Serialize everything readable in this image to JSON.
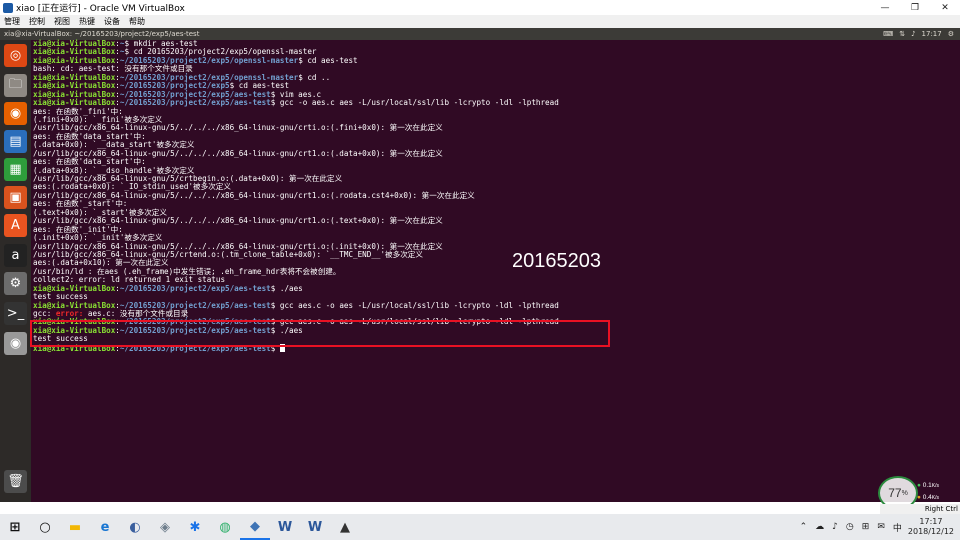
{
  "window": {
    "title": "xiao [正在运行] - Oracle VM VirtualBox",
    "minimize": "—",
    "restore": "❐",
    "close": "✕"
  },
  "vbox_menu": [
    "管理",
    "控制",
    "视图",
    "热键",
    "设备",
    "帮助"
  ],
  "ubuntu_topbar": {
    "title": "xia@xia-VirtualBox: ~/20165203/project2/exp5/aes-test",
    "time": "17:17"
  },
  "launcher": [
    {
      "name": "ubuntu-dash-icon",
      "glyph": "◎",
      "color": "#dd4814"
    },
    {
      "name": "files-icon",
      "glyph": "🗀",
      "color": "#8f8a84"
    },
    {
      "name": "firefox-icon",
      "glyph": "◉",
      "color": "#e66000"
    },
    {
      "name": "writer-icon",
      "glyph": "▤",
      "color": "#2a6ebb"
    },
    {
      "name": "calc-icon",
      "glyph": "▦",
      "color": "#2e9e3b"
    },
    {
      "name": "impress-icon",
      "glyph": "▣",
      "color": "#d9531e"
    },
    {
      "name": "software-center-icon",
      "glyph": "A",
      "color": "#e95420"
    },
    {
      "name": "amazon-icon",
      "glyph": "a",
      "color": "#222222"
    },
    {
      "name": "settings-icon",
      "glyph": "⚙",
      "color": "#6c6c6c"
    },
    {
      "name": "terminal-icon",
      "glyph": ">_",
      "color": "#333333"
    },
    {
      "name": "dvd-icon",
      "glyph": "◉",
      "color": "#999999"
    },
    {
      "name": "trash-icon",
      "glyph": "🗑",
      "color": "#4c4c4c"
    }
  ],
  "terminal": {
    "lines": [
      [
        {
          "t": "xia@xia-VirtualBox",
          "c": "pr"
        },
        {
          "t": ":",
          "c": ""
        },
        {
          "t": "~",
          "c": "pp"
        },
        {
          "t": "$ mkdir aes-test",
          "c": ""
        }
      ],
      [
        {
          "t": "xia@xia-VirtualBox",
          "c": "pr"
        },
        {
          "t": ":",
          "c": ""
        },
        {
          "t": "~",
          "c": "pp"
        },
        {
          "t": "$ cd 20165203/project2/exp5/openssl-master",
          "c": ""
        }
      ],
      [
        {
          "t": "xia@xia-VirtualBox",
          "c": "pr"
        },
        {
          "t": ":",
          "c": ""
        },
        {
          "t": "~/20165203/project2/exp5/openssl-master",
          "c": "pp"
        },
        {
          "t": "$ cd aes-test",
          "c": ""
        }
      ],
      [
        {
          "t": "bash: cd: aes-test: 没有那个文件或目录",
          "c": ""
        }
      ],
      [
        {
          "t": "xia@xia-VirtualBox",
          "c": "pr"
        },
        {
          "t": ":",
          "c": ""
        },
        {
          "t": "~/20165203/project2/exp5/openssl-master",
          "c": "pp"
        },
        {
          "t": "$ cd ..",
          "c": ""
        }
      ],
      [
        {
          "t": "xia@xia-VirtualBox",
          "c": "pr"
        },
        {
          "t": ":",
          "c": ""
        },
        {
          "t": "~/20165203/project2/exp5",
          "c": "pp"
        },
        {
          "t": "$ cd aes-test",
          "c": ""
        }
      ],
      [
        {
          "t": "xia@xia-VirtualBox",
          "c": "pr"
        },
        {
          "t": ":",
          "c": ""
        },
        {
          "t": "~/20165203/project2/exp5/aes-test",
          "c": "pp"
        },
        {
          "t": "$ vim aes.c",
          "c": ""
        }
      ],
      [
        {
          "t": "xia@xia-VirtualBox",
          "c": "pr"
        },
        {
          "t": ":",
          "c": ""
        },
        {
          "t": "~/20165203/project2/exp5/aes-test",
          "c": "pp"
        },
        {
          "t": "$ gcc -o aes.c aes -L/usr/local/ssl/lib -lcrypto -ldl -lpthread",
          "c": ""
        }
      ],
      [
        {
          "t": "aes: 在函数'_fini'中:",
          "c": ""
        }
      ],
      [
        {
          "t": "(.fini+0x0): `_fini'被多次定义",
          "c": ""
        }
      ],
      [
        {
          "t": "/usr/lib/gcc/x86_64-linux-gnu/5/../../../x86_64-linux-gnu/crti.o:(.fini+0x0): 第一次在此定义",
          "c": ""
        }
      ],
      [
        {
          "t": "aes: 在函数'data_start'中:",
          "c": ""
        }
      ],
      [
        {
          "t": "(.data+0x0): `__data_start'被多次定义",
          "c": ""
        }
      ],
      [
        {
          "t": "/usr/lib/gcc/x86_64-linux-gnu/5/../../../x86_64-linux-gnu/crt1.o:(.data+0x0): 第一次在此定义",
          "c": ""
        }
      ],
      [
        {
          "t": "aes: 在函数'data_start'中:",
          "c": ""
        }
      ],
      [
        {
          "t": "(.data+0x8): `__dso_handle'被多次定义",
          "c": ""
        }
      ],
      [
        {
          "t": "/usr/lib/gcc/x86_64-linux-gnu/5/crtbegin.o:(.data+0x0): 第一次在此定义",
          "c": ""
        }
      ],
      [
        {
          "t": "aes:(.rodata+0x0): `_IO_stdin_used'被多次定义",
          "c": ""
        }
      ],
      [
        {
          "t": "/usr/lib/gcc/x86_64-linux-gnu/5/../../../x86_64-linux-gnu/crt1.o:(.rodata.cst4+0x0): 第一次在此定义",
          "c": ""
        }
      ],
      [
        {
          "t": "aes: 在函数'_start'中:",
          "c": ""
        }
      ],
      [
        {
          "t": "(.text+0x0): `_start'被多次定义",
          "c": ""
        }
      ],
      [
        {
          "t": "/usr/lib/gcc/x86_64-linux-gnu/5/../../../x86_64-linux-gnu/crt1.o:(.text+0x0): 第一次在此定义",
          "c": ""
        }
      ],
      [
        {
          "t": "aes: 在函数'_init'中:",
          "c": ""
        }
      ],
      [
        {
          "t": "(.init+0x0): `_init'被多次定义",
          "c": ""
        }
      ],
      [
        {
          "t": "/usr/lib/gcc/x86_64-linux-gnu/5/../../../x86_64-linux-gnu/crti.o:(.init+0x0): 第一次在此定义",
          "c": ""
        }
      ],
      [
        {
          "t": "/usr/lib/gcc/x86_64-linux-gnu/5/crtend.o:(.tm_clone_table+0x0): `__TMC_END__'被多次定义",
          "c": ""
        }
      ],
      [
        {
          "t": "aes:(.data+0x10): 第一次在此定义",
          "c": ""
        }
      ],
      [
        {
          "t": "/usr/bin/ld : 在aes (.eh_frame)中发生错误; .eh_frame_hdr表将不会被创建。",
          "c": ""
        }
      ],
      [
        {
          "t": "collect2: error: ld returned 1 exit status",
          "c": ""
        }
      ],
      [
        {
          "t": "xia@xia-VirtualBox",
          "c": "pr"
        },
        {
          "t": ":",
          "c": ""
        },
        {
          "t": "~/20165203/project2/exp5/aes-test",
          "c": "pp"
        },
        {
          "t": "$ ./aes",
          "c": ""
        }
      ],
      [
        {
          "t": "test success",
          "c": ""
        }
      ],
      [
        {
          "t": "xia@xia-VirtualBox",
          "c": "pr"
        },
        {
          "t": ":",
          "c": ""
        },
        {
          "t": "~/20165203/project2/exp5/aes-test",
          "c": "pp"
        },
        {
          "t": "$ gcc aes.c -o aes -L/usr/local/ssl/lib -lcrypto -ldl -lpthread",
          "c": ""
        }
      ],
      [
        {
          "t": "gcc: ",
          "c": ""
        },
        {
          "t": "error: ",
          "c": "err"
        },
        {
          "t": "aes.c: 没有那个文件或目录",
          "c": ""
        }
      ],
      [
        {
          "t": "xia@xia-VirtualBox",
          "c": "pr"
        },
        {
          "t": ":",
          "c": ""
        },
        {
          "t": "~/20165203/project2/exp5/aes-test",
          "c": "pp"
        },
        {
          "t": "$ gcc aes.c -o aes -L/usr/local/ssl/lib -lcrypto -ldl -lpthread",
          "c": ""
        }
      ],
      [
        {
          "t": "xia@xia-VirtualBox",
          "c": "pr"
        },
        {
          "t": ":",
          "c": ""
        },
        {
          "t": "~/20165203/project2/exp5/aes-test",
          "c": "pp"
        },
        {
          "t": "$ ./aes",
          "c": ""
        }
      ],
      [
        {
          "t": "test success",
          "c": ""
        }
      ],
      [
        {
          "t": "xia@xia-VirtualBox",
          "c": "pr"
        },
        {
          "t": ":",
          "c": ""
        },
        {
          "t": "~/20165203/project2/exp5/aes-test",
          "c": "pp"
        },
        {
          "t": "$ ",
          "c": ""
        },
        {
          "t": "",
          "c": "cursor"
        }
      ]
    ],
    "watermark": "20165203"
  },
  "perf": {
    "value": "77",
    "unit": "%",
    "up": "0.1",
    "up_unit": "K/s",
    "down": "0.4",
    "down_unit": "K/s"
  },
  "vbox_status": "Right Ctrl",
  "taskbar": [
    {
      "name": "start-button",
      "glyph": "⊞",
      "color": "#111111",
      "interact": true
    },
    {
      "name": "cortana-icon",
      "glyph": "○",
      "color": "#111111",
      "interact": true
    },
    {
      "name": "file-explorer-icon",
      "glyph": "▬",
      "color": "#f2b705",
      "interact": true
    },
    {
      "name": "edge-icon",
      "glyph": "e",
      "color": "#1976d2",
      "interact": true
    },
    {
      "name": "app-icon-1",
      "glyph": "◐",
      "color": "#3a5f9e",
      "interact": true
    },
    {
      "name": "app-icon-2",
      "glyph": "◈",
      "color": "#6d7d8b",
      "interact": true
    },
    {
      "name": "app-icon-3",
      "glyph": "✱",
      "color": "#1a73e8",
      "interact": true
    },
    {
      "name": "wechat-icon",
      "glyph": "◍",
      "color": "#2aae67",
      "interact": true
    },
    {
      "name": "virtualbox-icon",
      "glyph": "◆",
      "color": "#3f74b5",
      "interact": true
    },
    {
      "name": "word-icon",
      "glyph": "W",
      "color": "#2b579a",
      "interact": true
    },
    {
      "name": "word-icon-2",
      "glyph": "W",
      "color": "#2b579a",
      "interact": true
    },
    {
      "name": "photos-icon",
      "glyph": "▲",
      "color": "#333333",
      "interact": true
    }
  ],
  "tray": {
    "icons": [
      "⌃",
      "☁",
      "♪",
      "◷",
      "⊞",
      "✉"
    ],
    "ime": "中",
    "time": "17:17",
    "date": "2018/12/12"
  }
}
